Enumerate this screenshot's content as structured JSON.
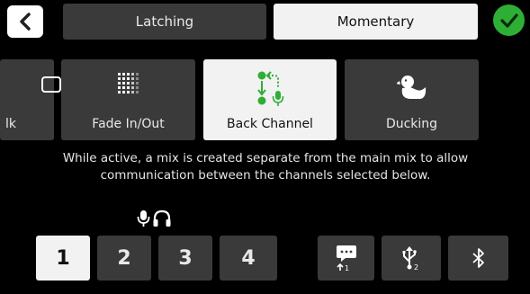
{
  "mode": {
    "latching_label": "Latching",
    "momentary_label": "Momentary",
    "selected": "Momentary"
  },
  "functions": {
    "talk_label": "lk",
    "fade_label": "Fade In/Out",
    "back_channel_label": "Back Channel",
    "ducking_label": "Ducking",
    "selected": "Back Channel"
  },
  "description": "While active, a mix is created separate from the main mix to allow communication between the channels selected below.",
  "channels": [
    "1",
    "2",
    "3",
    "4"
  ],
  "selected_channel": "1",
  "sources": [
    {
      "icon": "chat-bubble-icon",
      "sub": "1"
    },
    {
      "icon": "usb-icon",
      "sub": "2"
    },
    {
      "icon": "bluetooth-icon",
      "sub": ""
    }
  ],
  "colors": {
    "accent_green": "#2fae35",
    "tile_dark": "#3a3a3a",
    "tile_active": "#f2f2f2"
  }
}
